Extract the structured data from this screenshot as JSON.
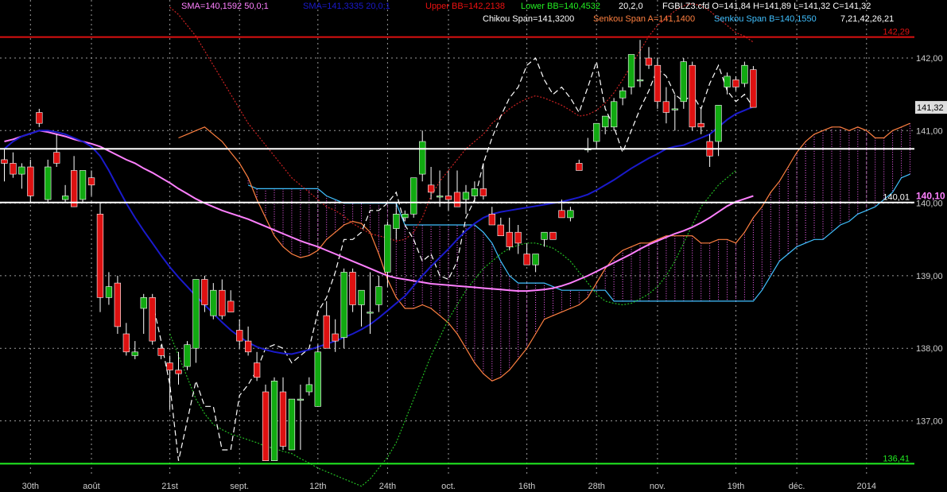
{
  "chart_data": {
    "type": "candlestick",
    "instrument_line": "FGBLZ3.cfd O=141,84 H=141,89 L=141,32 C=141,32",
    "y_axis": {
      "ylim": [
        136.25,
        142.8
      ],
      "ticks": [
        137,
        138,
        139,
        140,
        141,
        142
      ],
      "tick_labels": [
        "137,00",
        "138,00",
        "139,00",
        "140,00",
        "141,00",
        "142,00"
      ],
      "grid": true
    },
    "x_axis": {
      "tick_labels": [
        "30th",
        "août",
        "21st",
        "sept.",
        "12th",
        "24th",
        "oct.",
        "16th",
        "28th",
        "nov.",
        "19th",
        "déc.",
        "2014"
      ],
      "tick_index": [
        3,
        10,
        19,
        27,
        36,
        44,
        51,
        60,
        68,
        75,
        84,
        91,
        99
      ],
      "n_slots": 105
    },
    "legend": [
      {
        "text": "SMA=140,1592  50,0;1",
        "color": "#ff80ff"
      },
      {
        "text": "SMA=141,3335  20,0;1",
        "color": "#1a1acc"
      },
      {
        "text": "Upper BB=142,2138",
        "color": "#ee1111"
      },
      {
        "text": "Lower BB=140,4532",
        "color": "#22ee22"
      },
      {
        "text": "20,2,0",
        "color": "#ffffff"
      },
      {
        "text": "Chikou Span=141,3200",
        "color": "#ffffff"
      },
      {
        "text": "Senkou Span A=141,1400",
        "color": "#ff8040"
      },
      {
        "text": "Senkou Span B=140,1550",
        "color": "#40c0ff"
      },
      {
        "text": "7,21,42,26,21",
        "color": "#ffffff"
      }
    ],
    "horizontal_lines": [
      {
        "value": 142.29,
        "label": "142,29",
        "color": "#dd1111"
      },
      {
        "value": 140.75,
        "label": "",
        "color": "#ffffff"
      },
      {
        "value": 140.01,
        "label": "140,01",
        "color": "#ffffff"
      },
      {
        "value": 136.41,
        "label": "136,41",
        "color": "#22ee22"
      }
    ],
    "last_price": {
      "value": 141.32,
      "label": "141,32"
    },
    "sma50_value": {
      "value": 140.1,
      "label": "140,10"
    },
    "colors": {
      "up": "#11aa11",
      "down": "#dd1111",
      "sma50": "#ff80ff",
      "sma20": "#1a1acc",
      "upper_bb": "#cc2222",
      "lower_bb": "#22bb22",
      "chikou": "#ffffff",
      "span_a": "#ff8040",
      "span_b": "#40c0ff",
      "cloud": "#ff66ff",
      "grid": "#9a9a9a",
      "axis_text": "#cccccc"
    },
    "candles": [
      {
        "o": 140.6,
        "h": 140.75,
        "l": 140.3,
        "c": 140.55
      },
      {
        "o": 140.55,
        "h": 140.7,
        "l": 140.35,
        "c": 140.4
      },
      {
        "o": 140.4,
        "h": 140.55,
        "l": 140.2,
        "c": 140.5
      },
      {
        "o": 140.5,
        "h": 140.6,
        "l": 140.0,
        "c": 140.1
      },
      {
        "o": 141.25,
        "h": 141.3,
        "l": 141.05,
        "c": 141.1
      },
      {
        "o": 140.05,
        "h": 140.6,
        "l": 140.0,
        "c": 140.5
      },
      {
        "o": 140.7,
        "h": 140.95,
        "l": 140.5,
        "c": 140.55
      },
      {
        "o": 140.05,
        "h": 140.25,
        "l": 140.0,
        "c": 140.1
      },
      {
        "o": 140.45,
        "h": 140.65,
        "l": 139.95,
        "c": 139.95
      },
      {
        "o": 140.05,
        "h": 140.45,
        "l": 140.0,
        "c": 140.45
      },
      {
        "o": 140.35,
        "h": 140.45,
        "l": 140.1,
        "c": 140.25
      },
      {
        "o": 139.85,
        "h": 140.0,
        "l": 138.5,
        "c": 138.7
      },
      {
        "o": 138.7,
        "h": 139.05,
        "l": 138.6,
        "c": 138.85
      },
      {
        "o": 138.9,
        "h": 139.0,
        "l": 138.2,
        "c": 138.3
      },
      {
        "o": 138.2,
        "h": 138.35,
        "l": 137.9,
        "c": 137.95
      },
      {
        "o": 137.9,
        "h": 138.1,
        "l": 137.85,
        "c": 137.95
      },
      {
        "o": 138.55,
        "h": 138.75,
        "l": 138.2,
        "c": 138.7
      },
      {
        "o": 138.7,
        "h": 138.75,
        "l": 138.05,
        "c": 138.1
      },
      {
        "o": 138.0,
        "h": 138.05,
        "l": 137.85,
        "c": 137.9
      },
      {
        "o": 137.8,
        "h": 137.9,
        "l": 137.15,
        "c": 137.7
      },
      {
        "o": 137.7,
        "h": 137.95,
        "l": 137.5,
        "c": 137.65
      },
      {
        "o": 137.75,
        "h": 138.1,
        "l": 137.7,
        "c": 138.05
      },
      {
        "o": 138.0,
        "h": 138.95,
        "l": 137.8,
        "c": 138.95
      },
      {
        "o": 138.95,
        "h": 139.0,
        "l": 138.5,
        "c": 138.6
      },
      {
        "o": 138.45,
        "h": 138.9,
        "l": 138.4,
        "c": 138.8
      },
      {
        "o": 138.8,
        "h": 138.95,
        "l": 138.4,
        "c": 138.45
      },
      {
        "o": 138.65,
        "h": 138.8,
        "l": 138.5,
        "c": 138.5
      },
      {
        "o": 138.25,
        "h": 138.4,
        "l": 138.0,
        "c": 138.1
      },
      {
        "o": 138.1,
        "h": 138.3,
        "l": 137.9,
        "c": 137.95
      },
      {
        "o": 137.8,
        "h": 137.95,
        "l": 137.55,
        "c": 137.6
      },
      {
        "o": 137.4,
        "h": 137.5,
        "l": 136.45,
        "c": 136.45
      },
      {
        "o": 136.45,
        "h": 137.6,
        "l": 136.45,
        "c": 137.55
      },
      {
        "o": 137.4,
        "h": 137.6,
        "l": 136.6,
        "c": 136.65
      },
      {
        "o": 136.6,
        "h": 137.3,
        "l": 136.6,
        "c": 137.3
      },
      {
        "o": 137.3,
        "h": 137.5,
        "l": 136.6,
        "c": 137.3
      },
      {
        "o": 137.4,
        "h": 137.6,
        "l": 137.35,
        "c": 137.5
      },
      {
        "o": 137.2,
        "h": 138.05,
        "l": 137.2,
        "c": 137.95
      },
      {
        "o": 138.45,
        "h": 138.65,
        "l": 138.0,
        "c": 138.0
      },
      {
        "o": 138.2,
        "h": 138.4,
        "l": 137.95,
        "c": 138.1
      },
      {
        "o": 138.15,
        "h": 139.1,
        "l": 138.0,
        "c": 139.05
      },
      {
        "o": 139.05,
        "h": 139.1,
        "l": 138.5,
        "c": 138.6
      },
      {
        "o": 138.6,
        "h": 138.8,
        "l": 138.3,
        "c": 138.8
      },
      {
        "o": 138.5,
        "h": 139.05,
        "l": 138.2,
        "c": 138.5
      },
      {
        "o": 138.6,
        "h": 139.0,
        "l": 138.5,
        "c": 138.85
      },
      {
        "o": 139.05,
        "h": 139.75,
        "l": 138.85,
        "c": 139.7
      },
      {
        "o": 139.65,
        "h": 140.0,
        "l": 139.5,
        "c": 139.85
      },
      {
        "o": 139.8,
        "h": 139.9,
        "l": 139.75,
        "c": 139.85
      },
      {
        "o": 139.85,
        "h": 140.35,
        "l": 139.8,
        "c": 140.35
      },
      {
        "o": 140.4,
        "h": 141.0,
        "l": 140.3,
        "c": 140.85
      },
      {
        "o": 140.25,
        "h": 140.5,
        "l": 140.05,
        "c": 140.15
      },
      {
        "o": 140.1,
        "h": 140.45,
        "l": 139.95,
        "c": 140.1
      },
      {
        "o": 140.1,
        "h": 140.45,
        "l": 139.9,
        "c": 140.05
      },
      {
        "o": 140.15,
        "h": 140.45,
        "l": 139.95,
        "c": 139.95
      },
      {
        "o": 140.05,
        "h": 140.25,
        "l": 139.85,
        "c": 140.15
      },
      {
        "o": 140.1,
        "h": 140.3,
        "l": 140.0,
        "c": 140.2
      },
      {
        "o": 140.2,
        "h": 140.55,
        "l": 140.05,
        "c": 140.1
      },
      {
        "o": 139.85,
        "h": 139.95,
        "l": 139.7,
        "c": 139.7
      },
      {
        "o": 139.7,
        "h": 139.8,
        "l": 139.55,
        "c": 139.55
      },
      {
        "o": 139.6,
        "h": 139.8,
        "l": 139.35,
        "c": 139.4
      },
      {
        "o": 139.6,
        "h": 139.7,
        "l": 139.3,
        "c": 139.45
      },
      {
        "o": 139.3,
        "h": 139.45,
        "l": 139.15,
        "c": 139.15
      },
      {
        "o": 139.15,
        "h": 139.3,
        "l": 139.05,
        "c": 139.3
      },
      {
        "o": 139.5,
        "h": 139.6,
        "l": 139.4,
        "c": 139.6
      },
      {
        "o": 139.6,
        "h": 139.6,
        "l": 139.5,
        "c": 139.5
      },
      {
        "o": 139.9,
        "h": 140.05,
        "l": 139.8,
        "c": 139.8
      },
      {
        "o": 139.8,
        "h": 139.95,
        "l": 139.75,
        "c": 139.9
      },
      {
        "o": 140.55,
        "h": 140.6,
        "l": 140.45,
        "c": 140.45
      },
      {
        "o": 140.75,
        "h": 140.9,
        "l": 140.7,
        "c": 140.75
      },
      {
        "o": 140.85,
        "h": 141.1,
        "l": 140.75,
        "c": 141.1
      },
      {
        "o": 141.05,
        "h": 141.2,
        "l": 140.95,
        "c": 141.2
      },
      {
        "o": 141.05,
        "h": 141.45,
        "l": 141.0,
        "c": 141.4
      },
      {
        "o": 141.45,
        "h": 141.6,
        "l": 141.35,
        "c": 141.55
      },
      {
        "o": 141.6,
        "h": 142.05,
        "l": 141.5,
        "c": 142.05
      },
      {
        "o": 141.7,
        "h": 142.25,
        "l": 141.6,
        "c": 141.7
      },
      {
        "o": 142.0,
        "h": 142.15,
        "l": 141.85,
        "c": 141.9
      },
      {
        "o": 141.9,
        "h": 142.0,
        "l": 141.3,
        "c": 141.4
      },
      {
        "o": 141.4,
        "h": 141.6,
        "l": 141.1,
        "c": 141.25
      },
      {
        "o": 141.3,
        "h": 141.5,
        "l": 141.0,
        "c": 141.3
      },
      {
        "o": 141.4,
        "h": 142.0,
        "l": 141.3,
        "c": 141.95
      },
      {
        "o": 141.9,
        "h": 141.95,
        "l": 141.0,
        "c": 141.05
      },
      {
        "o": 141.1,
        "h": 141.3,
        "l": 140.95,
        "c": 141.05
      },
      {
        "o": 140.85,
        "h": 140.95,
        "l": 140.5,
        "c": 140.65
      },
      {
        "o": 140.85,
        "h": 141.35,
        "l": 140.65,
        "c": 141.35
      },
      {
        "o": 141.6,
        "h": 141.8,
        "l": 141.5,
        "c": 141.75
      },
      {
        "o": 141.7,
        "h": 141.75,
        "l": 141.55,
        "c": 141.6
      },
      {
        "o": 141.65,
        "h": 141.95,
        "l": 141.6,
        "c": 141.9
      },
      {
        "o": 141.84,
        "h": 141.89,
        "l": 141.32,
        "c": 141.32
      }
    ],
    "sma50": [
      140.85,
      140.88,
      140.92,
      140.96,
      141.0,
      140.98,
      140.95,
      140.92,
      140.88,
      140.85,
      140.82,
      140.78,
      140.72,
      140.66,
      140.6,
      140.55,
      140.48,
      140.42,
      140.35,
      140.28,
      140.2,
      140.13,
      140.06,
      140.0,
      139.95,
      139.9,
      139.86,
      139.82,
      139.78,
      139.73,
      139.68,
      139.63,
      139.58,
      139.53,
      139.48,
      139.44,
      139.4,
      139.35,
      139.3,
      139.25,
      139.2,
      139.15,
      139.1,
      139.05,
      139.0,
      138.97,
      138.95,
      138.93,
      138.91,
      138.89,
      138.88,
      138.87,
      138.86,
      138.85,
      138.84,
      138.83,
      138.82,
      138.81,
      138.8,
      138.79,
      138.79,
      138.8,
      138.81,
      138.83,
      138.86,
      138.9,
      138.95,
      139.0,
      139.06,
      139.12,
      139.18,
      139.24,
      139.3,
      139.37,
      139.43,
      139.48,
      139.53,
      139.58,
      139.62,
      139.67,
      139.73,
      139.8,
      139.88,
      139.96,
      140.02,
      140.06,
      140.1
    ],
    "sma20": [
      140.75,
      140.85,
      140.92,
      140.96,
      141.0,
      141.0,
      140.98,
      140.95,
      140.9,
      140.85,
      140.78,
      140.65,
      140.45,
      140.22,
      140.0,
      139.8,
      139.62,
      139.45,
      139.28,
      139.12,
      138.98,
      138.85,
      138.72,
      138.6,
      138.48,
      138.36,
      138.25,
      138.16,
      138.08,
      138.02,
      137.98,
      137.95,
      137.93,
      137.92,
      137.95,
      137.98,
      138.02,
      138.06,
      138.1,
      138.15,
      138.2,
      138.26,
      138.33,
      138.42,
      138.52,
      138.62,
      138.72,
      138.86,
      139.0,
      139.13,
      139.25,
      139.37,
      139.5,
      139.62,
      139.72,
      139.8,
      139.85,
      139.88,
      139.9,
      139.92,
      139.94,
      139.96,
      139.98,
      140.0,
      140.02,
      140.05,
      140.08,
      140.12,
      140.18,
      140.25,
      140.32,
      140.4,
      140.48,
      140.55,
      140.62,
      140.68,
      140.75,
      140.78,
      140.8,
      140.85,
      140.9,
      140.95,
      141.05,
      141.15,
      141.23,
      141.28,
      141.33
    ],
    "upper_bb": [
      null,
      null,
      null,
      null,
      null,
      null,
      null,
      null,
      null,
      null,
      null,
      null,
      null,
      null,
      null,
      null,
      null,
      null,
      null,
      142.7,
      142.6,
      142.45,
      142.3,
      142.1,
      141.9,
      141.7,
      141.5,
      141.3,
      141.1,
      140.95,
      140.8,
      140.65,
      140.5,
      140.35,
      140.25,
      140.15,
      140.05,
      139.95,
      139.9,
      139.82,
      139.72,
      139.65,
      139.58,
      139.55,
      139.52,
      139.48,
      139.5,
      139.6,
      139.8,
      140.1,
      140.3,
      140.45,
      140.6,
      140.75,
      140.85,
      140.95,
      141.1,
      141.2,
      141.3,
      141.38,
      141.44,
      141.48,
      141.45,
      141.4,
      141.35,
      141.28,
      141.2,
      141.22,
      141.28,
      141.38,
      141.52,
      141.7,
      141.9,
      142.1,
      142.3,
      142.45,
      142.55,
      142.65,
      142.72,
      142.75,
      142.72,
      142.65,
      142.55,
      142.45,
      142.35,
      142.3,
      142.22
    ],
    "lower_bb": [
      null,
      null,
      null,
      null,
      null,
      null,
      null,
      null,
      null,
      null,
      null,
      null,
      null,
      null,
      null,
      null,
      null,
      null,
      null,
      138.2,
      137.9,
      137.6,
      137.3,
      137.1,
      136.95,
      136.88,
      136.82,
      136.78,
      136.74,
      136.7,
      136.65,
      136.62,
      136.58,
      136.55,
      136.48,
      136.42,
      136.35,
      136.3,
      136.25,
      136.2,
      136.15,
      136.1,
      136.2,
      136.35,
      136.5,
      136.7,
      137.0,
      137.3,
      137.6,
      137.9,
      138.15,
      138.4,
      138.6,
      138.8,
      138.95,
      139.1,
      139.2,
      139.3,
      139.38,
      139.42,
      139.45,
      139.45,
      139.42,
      139.38,
      139.3,
      139.2,
      139.05,
      138.9,
      138.75,
      138.65,
      138.62,
      138.6,
      138.62,
      138.68,
      138.75,
      138.85,
      139.0,
      139.2,
      139.45,
      139.7,
      139.95,
      140.1,
      140.25,
      140.35,
      140.45
    ],
    "chikou": [
      null,
      null,
      null,
      null,
      null,
      null,
      null,
      null,
      null,
      null,
      null,
      null,
      null,
      null,
      null,
      null,
      null,
      138.65,
      138.1,
      137.5,
      136.45,
      137.0,
      137.55,
      137.2,
      137.2,
      136.6,
      136.6,
      137.35,
      137.5,
      137.7,
      138.0,
      138.05,
      138.0,
      137.8,
      137.9,
      138.0,
      138.5,
      138.7,
      139.05,
      139.5,
      139.5,
      139.6,
      139.9,
      139.9,
      140.0,
      140.15,
      139.7,
      139.5,
      139.2,
      139.3,
      139.0,
      138.95,
      139.2,
      139.8,
      140.05,
      140.55,
      140.9,
      141.2,
      141.45,
      141.6,
      141.9,
      142.0,
      141.7,
      141.5,
      141.6,
      141.45,
      141.25,
      141.6,
      141.95,
      141.3,
      141.05,
      140.7,
      141.0,
      141.3,
      141.55,
      141.85,
      141.75,
      141.5,
      141.4,
      141.5,
      141.3,
      141.65,
      141.9,
      141.55,
      141.4,
      141.5,
      141.32,
      null,
      null
    ],
    "span_a": [
      null,
      null,
      null,
      null,
      null,
      null,
      null,
      null,
      null,
      null,
      null,
      null,
      null,
      null,
      null,
      null,
      null,
      null,
      null,
      null,
      140.9,
      140.95,
      141.0,
      141.05,
      140.95,
      140.85,
      140.7,
      140.55,
      140.35,
      140.05,
      139.8,
      139.55,
      139.4,
      139.3,
      139.25,
      139.28,
      139.35,
      139.5,
      139.6,
      139.7,
      139.75,
      139.72,
      139.6,
      139.3,
      138.95,
      138.7,
      138.55,
      138.55,
      138.6,
      138.55,
      138.45,
      138.35,
      138.2,
      138.0,
      137.8,
      137.65,
      137.55,
      137.6,
      137.7,
      137.85,
      138.0,
      138.2,
      138.4,
      138.45,
      138.5,
      138.55,
      138.6,
      138.7,
      138.9,
      139.1,
      139.25,
      139.35,
      139.4,
      139.45,
      139.45,
      139.5,
      139.55,
      139.55,
      139.55,
      139.55,
      139.45,
      139.45,
      139.5,
      139.5,
      139.45,
      139.6,
      139.8,
      139.95,
      140.15,
      140.3,
      140.5,
      140.7,
      140.85,
      140.95,
      141.0,
      141.05,
      141.05,
      141.0,
      141.05,
      141.0,
      140.9,
      140.9,
      141.0,
      141.05,
      141.1
    ],
    "span_b": [
      null,
      null,
      null,
      null,
      null,
      null,
      null,
      null,
      null,
      null,
      null,
      null,
      null,
      null,
      null,
      null,
      null,
      null,
      null,
      null,
      null,
      null,
      null,
      null,
      null,
      null,
      null,
      null,
      140.25,
      140.2,
      140.2,
      140.2,
      140.2,
      140.2,
      140.2,
      140.2,
      140.2,
      140.1,
      140.05,
      140.0,
      140.0,
      140.0,
      140.0,
      140.0,
      140.0,
      140.0,
      139.7,
      139.7,
      139.7,
      139.7,
      139.7,
      139.7,
      139.7,
      139.7,
      139.7,
      139.6,
      139.45,
      139.2,
      139.0,
      138.9,
      138.9,
      138.9,
      138.9,
      138.85,
      138.8,
      138.8,
      138.8,
      138.8,
      138.8,
      138.8,
      138.65,
      138.65,
      138.65,
      138.65,
      138.65,
      138.65,
      138.65,
      138.65,
      138.65,
      138.65,
      138.65,
      138.65,
      138.65,
      138.65,
      138.65,
      138.65,
      138.65,
      138.8,
      139.0,
      139.2,
      139.3,
      139.4,
      139.45,
      139.5,
      139.5,
      139.6,
      139.7,
      139.75,
      139.85,
      139.9,
      139.95,
      140.05,
      140.15,
      140.35,
      140.4
    ]
  }
}
